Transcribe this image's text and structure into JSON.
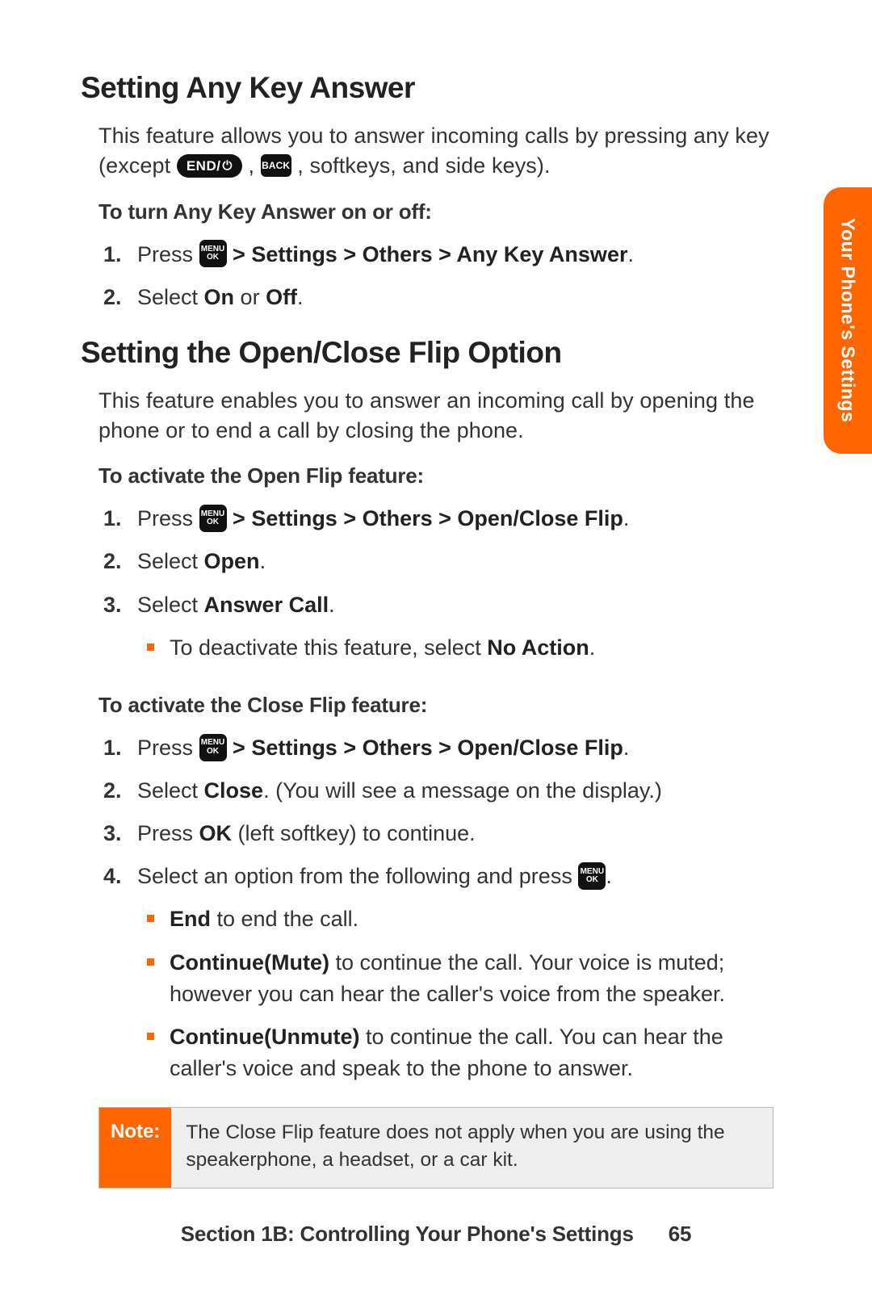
{
  "sideTab": "Your Phone's Settings",
  "keys": {
    "menuTop": "MENU",
    "menuBot": "OK",
    "end": "END/",
    "back": "BACK"
  },
  "s1": {
    "heading": "Setting Any Key Answer",
    "intro_a": "This feature allows you to answer incoming calls by pressing any key (except ",
    "intro_b": ", ",
    "intro_c": ", softkeys, and side keys).",
    "subA": "To turn Any Key Answer on or off:",
    "step1_a": "Press ",
    "step1_b": " > Settings > Others > Any Key Answer",
    "step1_c": ".",
    "step2_a": "Select ",
    "step2_on": "On",
    "step2_or": " or ",
    "step2_off": "Off",
    "step2_c": "."
  },
  "s2": {
    "heading": "Setting the Open/Close Flip Option",
    "intro": "This feature enables you to answer an incoming call by opening the phone or to end a call by closing the phone.",
    "subOpen": "To activate the Open Flip feature:",
    "o1_a": "Press ",
    "o1_b": " > Settings > Others > Open/Close Flip",
    "o1_c": ".",
    "o2_a": "Select ",
    "o2_b": "Open",
    "o2_c": ".",
    "o3_a": "Select ",
    "o3_b": "Answer Call",
    "o3_c": ".",
    "o3_bullet_a": "To deactivate this feature, select ",
    "o3_bullet_b": "No Action",
    "o3_bullet_c": ".",
    "subClose": "To activate the Close Flip feature:",
    "c1_a": "Press ",
    "c1_b": " > Settings > Others > Open/Close Flip",
    "c1_c": ".",
    "c2_a": "Select ",
    "c2_b": "Close",
    "c2_c": ". (You will see a message on the display.)",
    "c3_a": "Press ",
    "c3_b": "OK",
    "c3_c": " (left softkey) to continue.",
    "c4_a": "Select an option from the following and press ",
    "c4_c": ".",
    "c4_b1_a": "End",
    "c4_b1_b": " to end the call.",
    "c4_b2_a": "Continue(Mute)",
    "c4_b2_b": " to continue the call. Your voice is muted; however you can hear the caller's voice from the speaker.",
    "c4_b3_a": "Continue(Unmute)",
    "c4_b3_b": " to continue the call. You can hear the caller's voice and speak to the phone to answer."
  },
  "note": {
    "label": "Note:",
    "text": "The Close Flip feature does not apply  when you are using the speakerphone, a headset, or a car kit."
  },
  "footer": {
    "section": "Section 1B: Controlling Your Phone's Settings",
    "page": "65"
  }
}
